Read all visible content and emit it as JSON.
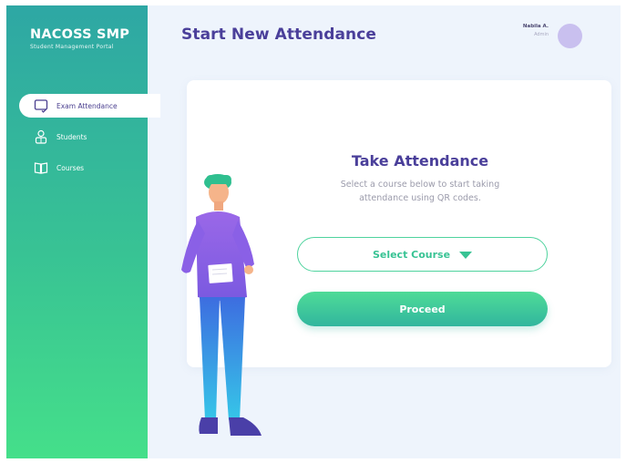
{
  "brand": {
    "title": "NACOSS SMP",
    "subtitle": "Student Management Portal"
  },
  "sidebar": {
    "items": [
      {
        "label": "Exam Attendance",
        "icon": "monitor-check-icon",
        "active": true
      },
      {
        "label": "Students",
        "icon": "user-icon",
        "active": false
      },
      {
        "label": "Courses",
        "icon": "book-icon",
        "active": false
      }
    ]
  },
  "header": {
    "title": "Start New Attendance"
  },
  "user": {
    "name": "Nabila A.",
    "role": "Admin"
  },
  "card": {
    "title": "Take Attendance",
    "desc_line1": "Select a course below to start taking",
    "desc_line2": "attendance using QR codes.",
    "select_label": "Select Course",
    "proceed_label": "Proceed"
  },
  "colors": {
    "accent_green": "#38c394",
    "accent_purple": "#4a3f9a",
    "sidebar_top": "#2ea7a4",
    "sidebar_bottom": "#45df8a"
  }
}
